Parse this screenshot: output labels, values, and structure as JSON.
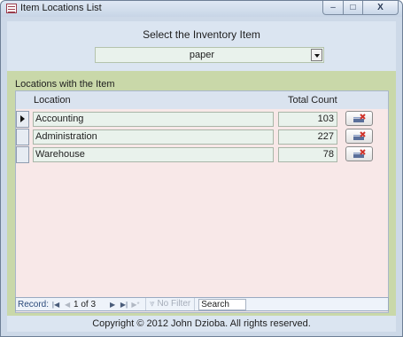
{
  "window": {
    "title": "Item Locations List",
    "buttons": {
      "minimize": "–",
      "maximize": "□",
      "close": "X"
    }
  },
  "header": {
    "prompt": "Select the Inventory Item",
    "item_select": {
      "value": "paper"
    }
  },
  "section": {
    "label": "Locations with the Item",
    "columns": {
      "location": "Location",
      "count": "Total Count"
    }
  },
  "rows": [
    {
      "location": "Accounting",
      "count": "103"
    },
    {
      "location": "Administration",
      "count": "227"
    },
    {
      "location": "Warehouse",
      "count": "78"
    }
  ],
  "navigation": {
    "label": "Record:",
    "position": "1 of 3",
    "filter": "No Filter",
    "search": "Search"
  },
  "footer": {
    "copyright": "Copyright © 2012 John Dzioba. All rights reserved."
  },
  "colors": {
    "accent": "#dbe5f1",
    "form_background": "#c9d8a9",
    "subform_background": "#f8e8e8",
    "field_background": "#e9f2ec"
  }
}
